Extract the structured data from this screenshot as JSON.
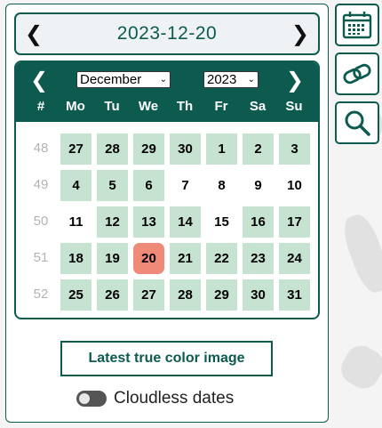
{
  "date_bar": {
    "prev_arrow": "❮",
    "date": "2023-12-20",
    "next_arrow": "❯"
  },
  "calendar": {
    "prev_arrow": "❮",
    "next_arrow": "❯",
    "month": "December",
    "year": "2023",
    "dropdown_chevron": "⌄",
    "week_header": "#",
    "weekdays": [
      "Mo",
      "Tu",
      "We",
      "Th",
      "Fr",
      "Sa",
      "Su"
    ],
    "weeks": [
      {
        "num": "48",
        "days": [
          "27",
          "28",
          "29",
          "30",
          "1",
          "2",
          "3"
        ]
      },
      {
        "num": "49",
        "days": [
          "4",
          "5",
          "6",
          "7",
          "8",
          "9",
          "10"
        ]
      },
      {
        "num": "50",
        "days": [
          "11",
          "12",
          "13",
          "14",
          "15",
          "16",
          "17"
        ]
      },
      {
        "num": "51",
        "days": [
          "18",
          "19",
          "20",
          "21",
          "22",
          "23",
          "24"
        ]
      },
      {
        "num": "52",
        "days": [
          "25",
          "26",
          "27",
          "28",
          "29",
          "30",
          "31"
        ]
      }
    ],
    "available": [
      [
        true,
        true,
        true,
        true,
        true,
        true,
        true
      ],
      [
        true,
        true,
        true,
        false,
        false,
        false,
        false
      ],
      [
        false,
        true,
        true,
        true,
        false,
        true,
        true
      ],
      [
        true,
        true,
        false,
        true,
        true,
        true,
        true
      ],
      [
        true,
        true,
        true,
        true,
        true,
        true,
        true
      ]
    ],
    "selected": {
      "week": 3,
      "day": 2
    }
  },
  "latest_button": "Latest true color image",
  "cloudless_toggle": {
    "label": "Cloudless dates",
    "on": false
  },
  "side_buttons": [
    "calendar-icon",
    "link-icon",
    "search-icon"
  ],
  "colors": {
    "primary": "#0d5b4f",
    "available": "#c6e3d2",
    "selected": "#ef8a78"
  }
}
